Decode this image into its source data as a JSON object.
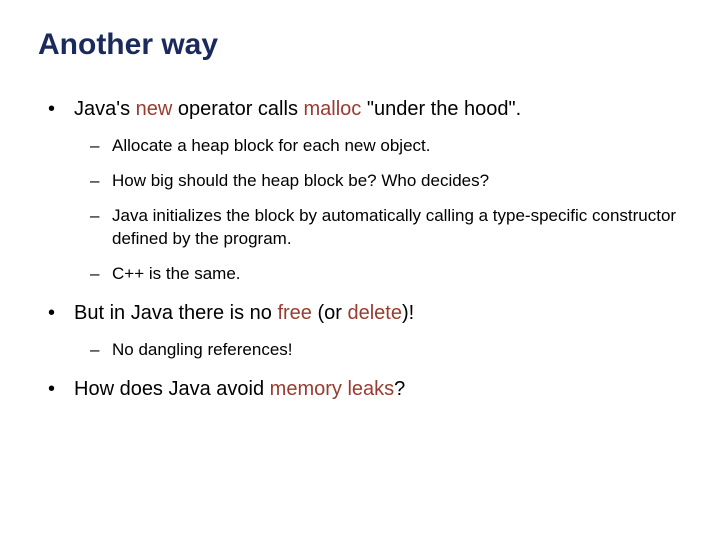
{
  "title": "Another way",
  "b1": {
    "pre": "Java's ",
    "kw1": "new",
    "mid": " operator calls ",
    "kw2": "malloc",
    "post": " \"under the hood\".",
    "sub": [
      "Allocate a heap block for each new object.",
      "How big should the heap block be?  Who decides?",
      "Java initializes the block by automatically calling a type-specific constructor defined by the program.",
      "C++ is the same."
    ]
  },
  "b2": {
    "pre": "But in Java there is no ",
    "kw1": "free",
    "mid": " (or ",
    "kw2": "delete",
    "post": ")!",
    "sub": [
      "No dangling references!"
    ]
  },
  "b3": {
    "pre": "How does Java avoid ",
    "kw1": "memory leaks",
    "post": "?"
  }
}
